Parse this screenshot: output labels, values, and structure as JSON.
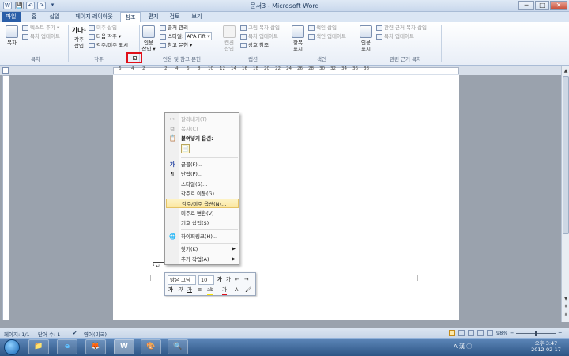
{
  "window": {
    "title": "문서3 - Microsoft Word",
    "minimize": "─",
    "maximize": "□",
    "close": "✕"
  },
  "quick_access": [
    "W",
    "💾",
    "↶",
    "↷",
    "▾"
  ],
  "tabs": [
    "파일",
    "홈",
    "삽입",
    "페이지 레이아웃",
    "참조",
    "편지",
    "검토",
    "보기"
  ],
  "active_tab": "참조",
  "ribbon": {
    "toc": {
      "big": "목차",
      "add_text": "텍스트 추가 ▾",
      "update": "목차 업데이트",
      "group": "목차"
    },
    "footnotes": {
      "insert_footnote_glyph": "가나¹",
      "insert_footnote": "각주\n삽입",
      "insert_endnote": "미주 삽입",
      "next_footnote": "다음 각주 ▾",
      "show_notes": "각주/미주 표시",
      "group": "각주",
      "launcher": "↘"
    },
    "citations": {
      "insert_citation": "인용\n삽입 ▾",
      "manage_sources": "출처 관리",
      "style_label": "스타일:",
      "style_value": "APA Fift ▾",
      "bibliography": "참고 문헌 ▾",
      "group": "인용 및 참고 문헌"
    },
    "captions": {
      "insert_caption": "캡션\n삽입",
      "insert_table_of_figures": "그림 목차 삽입",
      "update_table": "목차 업데이트",
      "cross_reference": "상호 참조",
      "group": "캡션"
    },
    "index": {
      "mark_entry": "항목\n표시",
      "insert_index": "색인 삽입",
      "update_index": "색인 업데이트",
      "group": "색인"
    },
    "toa": {
      "mark_citation": "인용\n표시",
      "insert_toa": "관련 근거 목차 삽입",
      "update_table": "목차 업데이트",
      "group": "관련 근거 목차"
    }
  },
  "ruler": {
    "numbers": [
      "6",
      "4",
      "2",
      "2",
      "4",
      "6",
      "8",
      "10",
      "12",
      "14",
      "16",
      "18",
      "20",
      "22",
      "24",
      "26",
      "28",
      "30",
      "32",
      "34",
      "36",
      "38"
    ]
  },
  "context_menu": {
    "items": [
      {
        "label": "잘라내기(T)",
        "icon": "✂",
        "disabled": true
      },
      {
        "label": "복사(C)",
        "icon": "⧉",
        "disabled": true
      },
      {
        "label": "붙여넣기 옵션:",
        "icon": "📋",
        "disabled": false,
        "bold": true
      },
      {
        "label": "글꼴(F)...",
        "icon": "가",
        "disabled": false
      },
      {
        "label": "단락(P)...",
        "icon": "¶",
        "disabled": false
      },
      {
        "label": "스타일(S)...",
        "icon": "",
        "disabled": false
      },
      {
        "label": "각주로 이동(G)",
        "icon": "",
        "disabled": false
      },
      {
        "label": "각주/미주 옵션(N)...",
        "icon": "",
        "disabled": false,
        "highlighted": true
      },
      {
        "label": "미주로 변환(V)",
        "icon": "",
        "disabled": false
      },
      {
        "label": "기호 삽입(S)",
        "icon": "",
        "disabled": false
      },
      {
        "label": "하이퍼링크(H)...",
        "icon": "🌐",
        "disabled": false
      },
      {
        "label": "찾기(K)",
        "icon": "",
        "disabled": false,
        "submenu": true
      },
      {
        "label": "추가 작업(A)",
        "icon": "",
        "disabled": false,
        "submenu": true
      }
    ],
    "paste_icon": "📄"
  },
  "mini_toolbar": {
    "font": "맑은 고딕",
    "size": "10",
    "grow": "가",
    "shrink": "가",
    "indent_dec": "⇤",
    "indent_inc": "⇥",
    "bold": "가",
    "italic": "가",
    "underline": "가",
    "align": "≡",
    "highlight": "ab",
    "font_color": "가",
    "format_painter": "🖌",
    "styles": "A"
  },
  "status_bar": {
    "page": "페이지: 1/1",
    "words": "단어 수: 1",
    "language": "영어(미국)",
    "zoom": "98%",
    "zoom_minus": "−",
    "zoom_plus": "+"
  },
  "taskbar": {
    "apps": [
      "📁",
      "e",
      "🦊",
      "W",
      "🎨",
      "🔍"
    ],
    "tray": "A 漢 ⓘ",
    "time": "오후 3:47",
    "date": "2012-02-17"
  },
  "colors": {
    "file_tab": "#2a5ea8",
    "highlight": "#fbe7a1",
    "red_box": "#e0101a"
  }
}
